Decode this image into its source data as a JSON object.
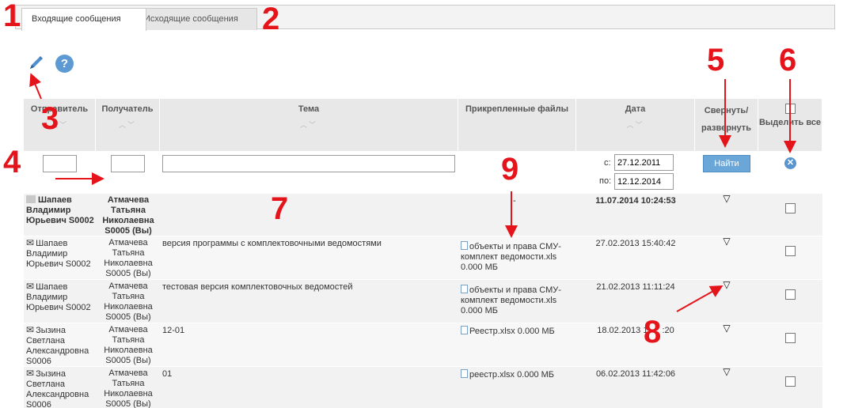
{
  "tabs": [
    {
      "label": "Входящие сообщения",
      "active": true
    },
    {
      "label": "Исходящие сообщения",
      "active": false
    }
  ],
  "toolbar": {
    "pencil_icon": "pencil-icon",
    "help_icon": "help-icon",
    "help_glyph": "?"
  },
  "table": {
    "headers": {
      "sender": "Отправитель",
      "recipient": "Получатель",
      "subject": "Тема",
      "files": "Прикрепленные файлы",
      "date": "Дата",
      "toggle": "Свернуть/ развернуть",
      "select": "Выделить все"
    },
    "sort_glyph": "^ v"
  },
  "filters": {
    "sender_value": "",
    "recipient_value": "",
    "subject_value": "",
    "date_from_label": "с:",
    "date_from": "27.12.2011",
    "date_to_label": "по:",
    "date_to": "12.12.2014",
    "find_button": "Найти",
    "clear_glyph": "✕"
  },
  "rows": [
    {
      "sender": "Шапаев Владимир Юрьевич S0002",
      "recipient": "Атмачева Татьяна Николаевна S0005 (Вы)",
      "subject": "",
      "files": "-",
      "date": "11.07.2014 10:24:53",
      "bold": true,
      "toggle": "▽"
    },
    {
      "sender": "Шапаев Владимир Юрьевич S0002",
      "recipient": "Атмачева Татьяна Николаевна S0005 (Вы)",
      "subject": "версия программы с комплектовочными ведомостями",
      "files": "объекты и права СМУ-комплект ведомости.xls 0.000 МБ",
      "date": "27.02.2013 15:40:42",
      "toggle": "▽"
    },
    {
      "sender": "Шапаев Владимир Юрьевич S0002",
      "recipient": "Атмачева Татьяна Николаевна S0005 (Вы)",
      "subject": "тестовая версия комплектовочных ведомостей",
      "files": "объекты и права СМУ-комплект ведомости.xls 0.000 МБ",
      "date": "21.02.2013 11:11:24",
      "toggle": "▽"
    },
    {
      "sender": "Зызина Светлана Александровна S0006",
      "recipient": "Атмачева Татьяна Николаевна S0005 (Вы)",
      "subject": "12-01",
      "files": "Реестр.xlsx 0.000 МБ",
      "date": "18.02.2013 1",
      "date_tail": ":20",
      "toggle": "▽"
    },
    {
      "sender": "Зызина Светлана Александровна S0006",
      "recipient": "Атмачева Татьяна Николаевна S0005 (Вы)",
      "subject": "01",
      "files": "реестр.xlsx 0.000 МБ",
      "date": "06.02.2013 11:42:06",
      "toggle": "▽"
    }
  ],
  "annotations": {
    "n1": "1",
    "n2": "2",
    "n3": "3",
    "n4": "4",
    "n5": "5",
    "n6": "6",
    "n7": "7",
    "n8": "8",
    "n9": "9",
    "color": "#e5141b"
  }
}
